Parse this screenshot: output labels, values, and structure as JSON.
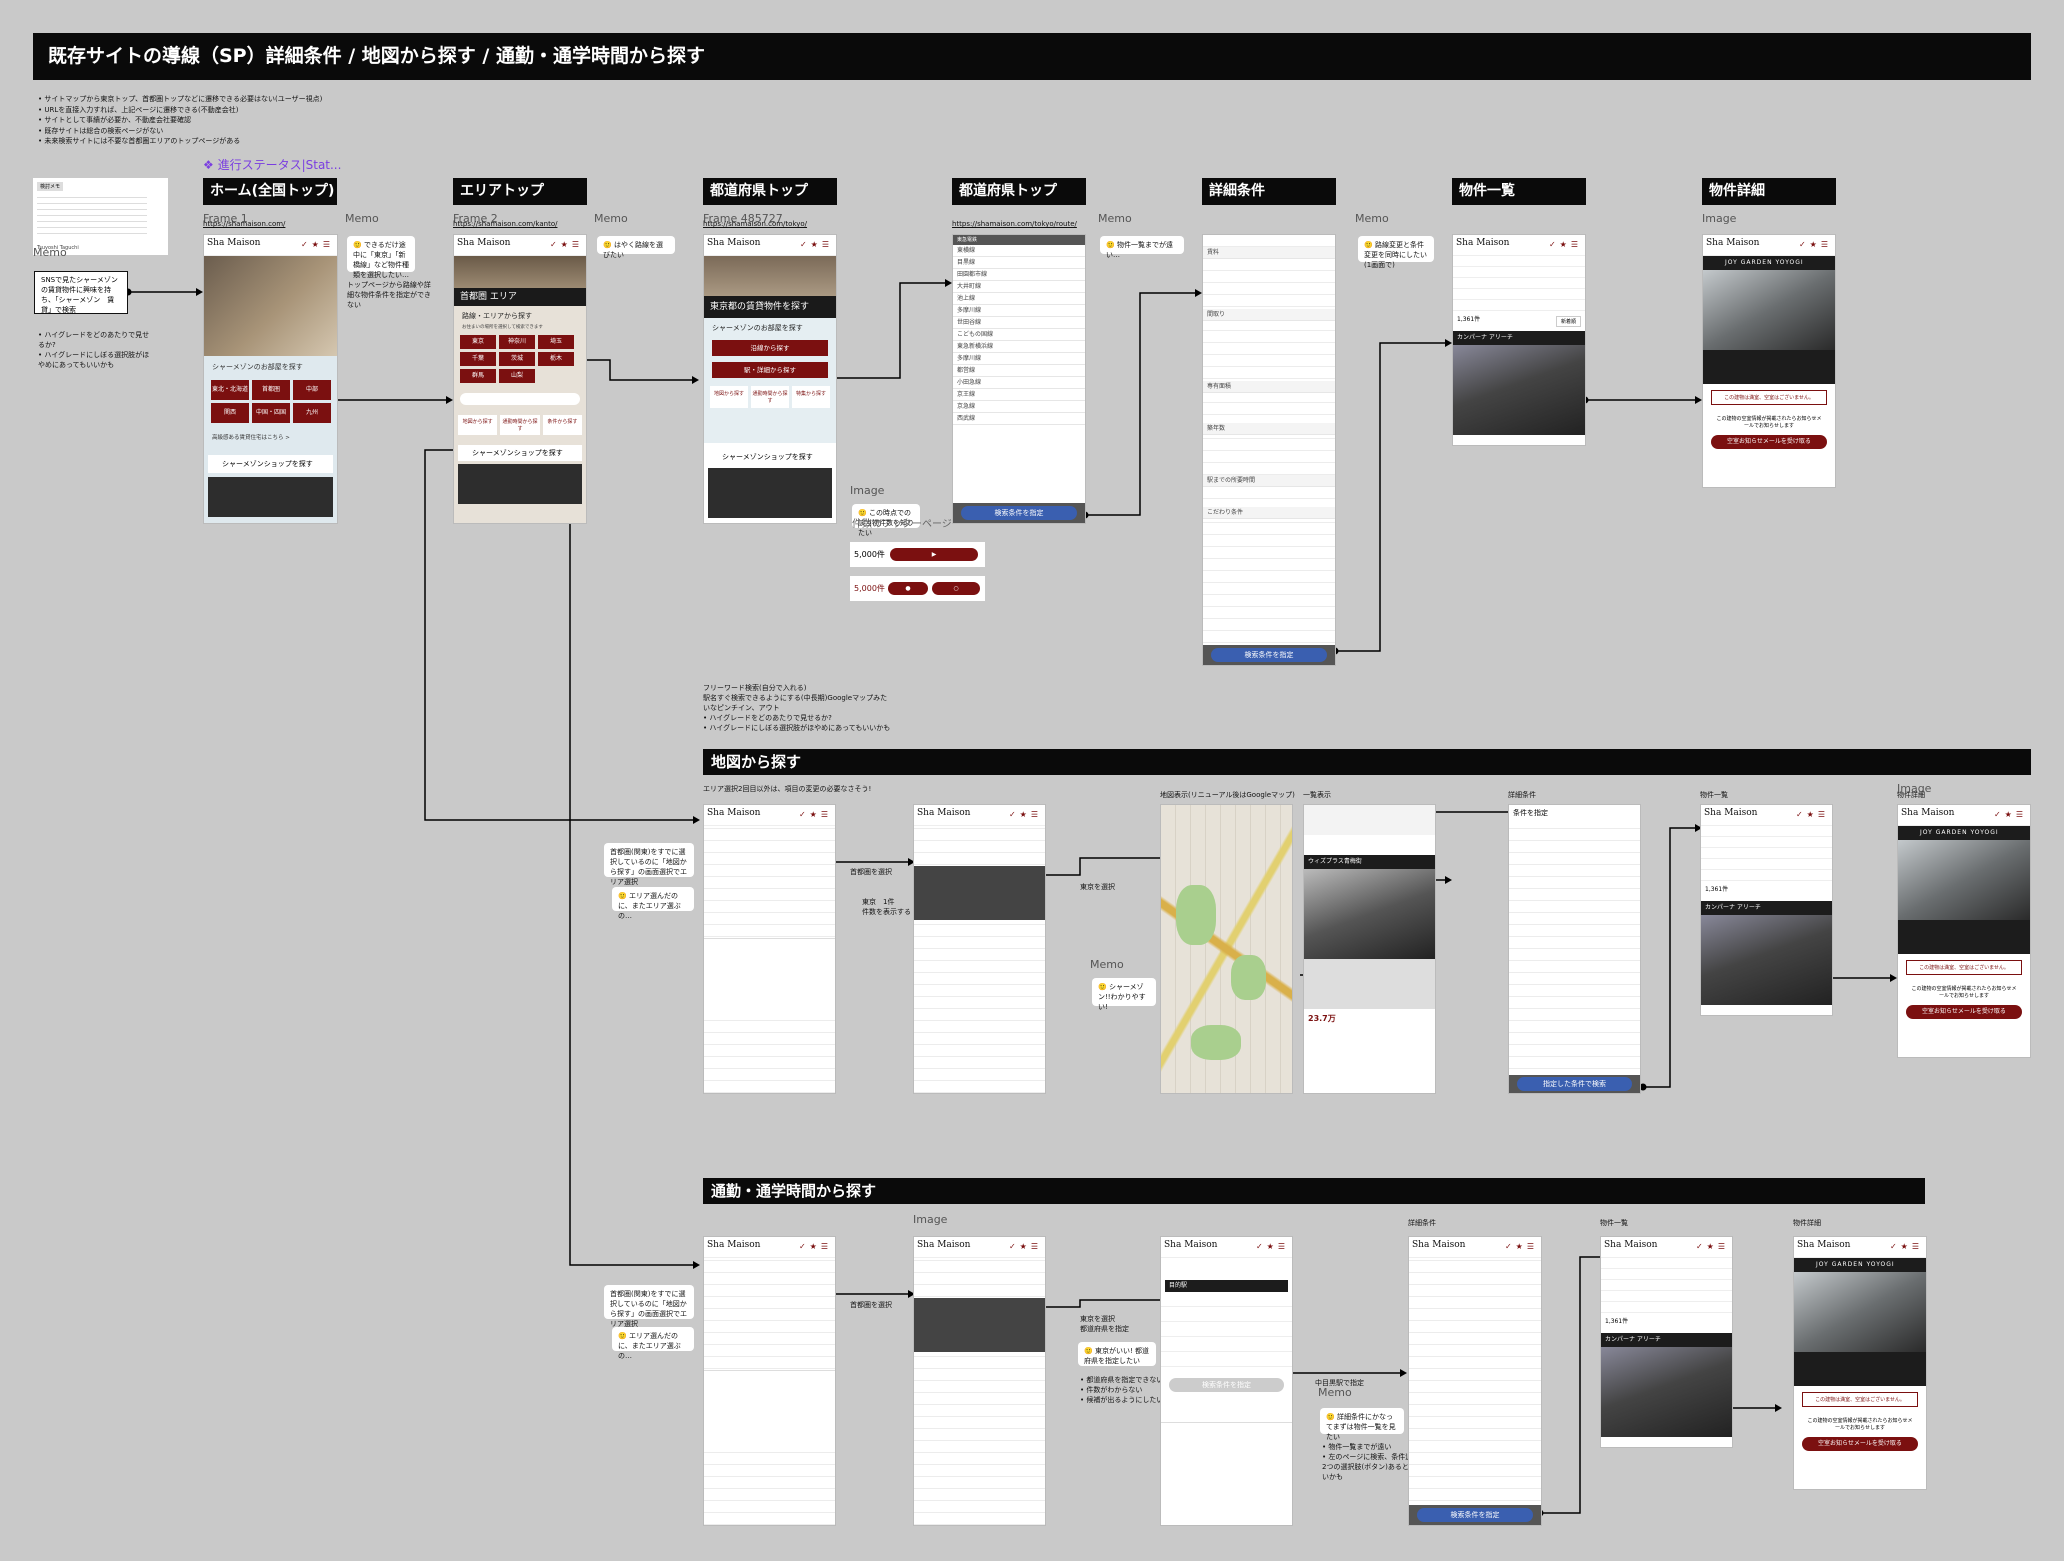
{
  "title": "既存サイトの導線（SP）詳細条件 / 地図から探す / 通勤・通学時間から探す",
  "notes": [
    "• サイトマップから東京トップ、首都圏トップなどに遷移できる必要はない(ユーザー視点)",
    "• URLを直接入力すれば、上記ページに遷移できる(不動産会社)",
    "• サイトとして事績が必要か、不動産会社要確認",
    "• 既存サイトは総合の検索ページがない",
    "• 未来検索サイトには不要な首都圏エリアのトップページがある"
  ],
  "status_label": "❖ 進行ステータス|Stat...",
  "columns": [
    {
      "label": "ホーム(全国トップ)",
      "frame": "Frame 1",
      "url": "https://shamaison.com/"
    },
    {
      "label": "エリアトップ",
      "frame": "Frame 2",
      "url": "https://shamaison.com/kanto/"
    },
    {
      "label": "都道府県トップ",
      "frame": "Frame 485727",
      "url": "https://shamaison.com/tokyo/"
    },
    {
      "label": "都道府県トップ",
      "frame": "",
      "url": "https://shamaison.com/tokyo/route/"
    },
    {
      "label": "詳細条件",
      "frame": "",
      "url": ""
    },
    {
      "label": "物件一覧",
      "frame": "",
      "url": ""
    },
    {
      "label": "物件詳細",
      "frame": "Image",
      "url": ""
    }
  ],
  "memo_labels": {
    "m1": "Memo",
    "m2": "Memo",
    "m3": "Memo",
    "m4": "Memo",
    "m5": "Memo",
    "image1": "Image"
  },
  "sticky": {
    "title": "検討メモ",
    "author": "Tsuyoshi Taguchi"
  },
  "entry_box": "SNSで見たシャーメゾンの賃貸物件に興味を持ち、「シャーメゾン　賃貸」で検索",
  "entry_note": "• ハイグレードをどのあたりで見せるか?\n• ハイグレードにしぼる選択肢がほやめにあってもいいかも",
  "memos": {
    "home": "🙂 できるだけ途中に「東京」「新橋線」など物件種類を選択したい…",
    "home_note": "トップページから路線や詳細な物件条件を指定ができない",
    "area": "🙂 はやく路線を選びたい",
    "route": "🙂 物件一覧までが遠い…",
    "detail": "🙂 路線変更と条件変更を同時にしたい(1画面で)",
    "image_note": "🙂 この時点での該当物件数を知りたい",
    "count1": "5,000件",
    "count2": "5,000件",
    "count_caption": "件数のフッターページ"
  },
  "home_screen": {
    "logo": "Sha Maison",
    "search_title": "シャーメゾンのお部屋を探す",
    "regions": [
      "東北・北海道",
      "首都圏",
      "中部",
      "関西",
      "中国・四国",
      "九州"
    ],
    "footer_link": "高級感ある賃貸住宅はこちら >",
    "shop": "シャーメゾンショップを探す"
  },
  "area_screen": {
    "hero": "首都圏 エリア",
    "box_title": "路線・エリアから探す",
    "box_sub": "お住まいの場所を選択して検索できます",
    "prefs": [
      "東京",
      "神奈川",
      "埼玉",
      "千葉",
      "茨城",
      "栃木",
      "群馬",
      "山梨"
    ],
    "tabs": [
      "地図から探す",
      "通勤時間から探す",
      "条件から探す"
    ],
    "shop": "シャーメゾンショップを探す"
  },
  "pref_screen": {
    "hero": "東京都の賃貸物件を探す",
    "search_title": "シャーメゾンのお部屋を探す",
    "btn1": "沿線から探す",
    "btn2": "駅・詳細から探す",
    "tabs": [
      "地図から探す",
      "通勤時間から探す",
      "特集から探す"
    ],
    "shop": "シャーメゾンショップを探す"
  },
  "route_screen": {
    "head": "東急電鉄",
    "lines": [
      "東横線",
      "目黒線",
      "田園都市線",
      "大井町線",
      "池上線",
      "多摩川線",
      "世田谷線",
      "こどもの国線",
      "東急新横浜線",
      "多摩川線",
      "都営線",
      "小田急線",
      "京王線",
      "京急線",
      "西武線"
    ],
    "cta": "検索条件を指定"
  },
  "detail_screen": {
    "labels": [
      "賃料",
      "間取り",
      "専有面積",
      "築年数",
      "駅までの所要時間",
      "こだわり条件"
    ],
    "cta": "検索条件を指定"
  },
  "list_screen": {
    "count": "1,361件",
    "sort": "新着順",
    "prop": "カンパーナ アリーチ"
  },
  "detail_page": {
    "name": "JOY GARDEN YOYOGI",
    "notice": "この建物は満室、空室はございません。",
    "mail_text": "この建物の空室情報が掲載されたらお知らせメールでお知らせします",
    "mail_btn": "空室お知らせメールを受け取る"
  },
  "map_section": {
    "banner": "地図から探す",
    "note": "エリア選択2回目以外は、項目の変更の必要なさそう!",
    "pre_note": "フリーワード検索(自分で入れる)\n駅名すぐ検索できるようにする(中長期)Googleマップみたいなピンチイン、アウト\n• ハイグレードをどのあたりで見せるか?\n• ハイグレードにしぼる選択肢がほやめにあってもいいかも",
    "memo_left": "首都圏(関東)をすでに選択しているのに「地図から探す」の画面選択でエリア選択",
    "memo_left2": "🙂 エリア選んだのに、またエリア選ぶの…",
    "step1": "首都圏を選択",
    "step2": "東京　1件\n件数を表示する",
    "step3": "東京を選択",
    "map_title": "地図表示(リニューアル後はGoogleマップ)",
    "list_title": "一覧表示",
    "detail_title": "詳細条件",
    "result_title": "物件一覧",
    "image_title": "物件詳細",
    "image_lbl": "Image",
    "memo_label": "Memo",
    "memo_map": "🙂 シャーメゾン!!わかりやすい!",
    "prop_name": "ウィズプラス青梅街",
    "price": "23.7万",
    "cond_title": "条件を指定",
    "cond_cta": "指定した条件で検索"
  },
  "commute_section": {
    "banner": "通勤・通学時間から探す",
    "image_lbl": "Image",
    "memo_label": "Memo",
    "memo_left": "首都圏(関東)をすでに選択しているのに「地図から探す」の画面選択でエリア選択",
    "memo_left2": "🙂 エリア選んだのに、またエリア選ぶの…",
    "step1": "首都圏を選択",
    "step2": "東京を選択\n都道府県を指定",
    "memo_mid": "🙂 東京がいい! 都道府県を指定したい",
    "mid_notes": "• 都道府県を指定できない\n• 件数がわからない\n• 候補が出るようにしたい",
    "step3": "中目黒駅で指定",
    "memo_right": "🙂 詳細条件にかなってまずは物件一覧を見たい",
    "right_notes": "• 物件一覧までが遠い\n• 左のページに検索、条件追加\n2つの選択肢(ボタン)あるといいかも",
    "detail_title": "詳細条件",
    "result_title": "物件一覧",
    "image_title": "物件詳細",
    "station_box": "目的駅",
    "cta": "検索条件を指定"
  },
  "colors": {
    "brand": "#7b1010",
    "cta": "#3a5fb0",
    "status": "#7a3ee0",
    "banner": "#0a0a0a"
  }
}
